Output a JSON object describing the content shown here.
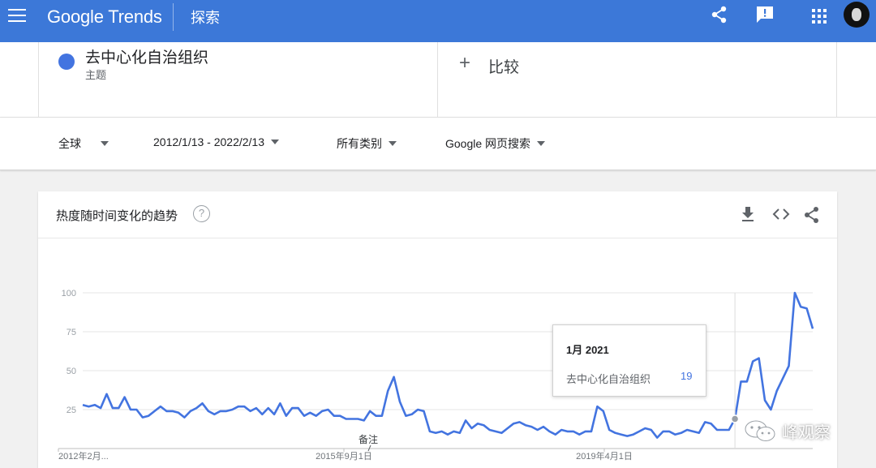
{
  "app": {
    "logo": "Google Trends",
    "section": "探索",
    "colors": {
      "brand": "#3c78d8",
      "series": "#4374e0",
      "tooltip_value": "#4374e0"
    },
    "icons": [
      "menu-icon",
      "share-icon",
      "feedback-icon",
      "apps-icon",
      "avatar"
    ]
  },
  "search_term": {
    "name": "去中心化自治组织",
    "type": "主题",
    "color": "#4374e0"
  },
  "compare": {
    "plus": "+",
    "label": "比较"
  },
  "filters": {
    "region": "全球",
    "date_range": "2012/1/13 - 2022/2/13",
    "category": "所有类别",
    "property": "Google 网页搜索"
  },
  "trend_card": {
    "title": "热度随时间变化的趋势",
    "help_symbol": "?",
    "header_icons": [
      "download-icon",
      "embed-icon",
      "share-icon"
    ],
    "note_label": "备注",
    "tooltip": {
      "date": "1月 2021",
      "series": "去中心化自治组织",
      "value": "19"
    }
  },
  "chart_data": {
    "type": "line",
    "series": [
      {
        "name": "去中心化自治组织",
        "color": "#4374e0",
        "values": [
          28,
          27,
          28,
          26,
          35,
          26,
          26,
          33,
          25,
          25,
          20,
          21,
          24,
          27,
          24,
          24,
          23,
          20,
          24,
          26,
          29,
          24,
          22,
          24,
          24,
          25,
          27,
          27,
          24,
          26,
          22,
          26,
          22,
          29,
          21,
          26,
          26,
          21,
          23,
          21,
          24,
          25,
          21,
          21,
          19,
          19,
          19,
          18,
          24,
          21,
          21,
          37,
          46,
          30,
          21,
          22,
          25,
          24,
          11,
          10,
          11,
          9,
          11,
          10,
          18,
          13,
          16,
          15,
          12,
          11,
          10,
          13,
          16,
          17,
          15,
          14,
          12,
          14,
          11,
          9,
          12,
          11,
          11,
          9,
          11,
          11,
          27,
          24,
          12,
          10,
          9,
          8,
          9,
          11,
          13,
          12,
          7,
          11,
          11,
          9,
          10,
          12,
          11,
          10,
          17,
          16,
          12,
          12,
          12,
          19,
          43,
          43,
          56,
          58,
          31,
          25,
          37,
          45,
          53,
          100,
          91,
          90,
          77
        ]
      }
    ],
    "x_range": [
      "2012-01-13",
      "2022-02-13"
    ],
    "x_tick_labels": [
      "2012年2月...",
      "2015年9月1日",
      "2019年4月1日"
    ],
    "y_ticks": [
      25,
      50,
      75,
      100
    ],
    "ylim": [
      0,
      100
    ],
    "grid": true,
    "hover_point": {
      "label": "1月 2021",
      "value": 19
    }
  },
  "watermark": {
    "text": "峰观察"
  }
}
